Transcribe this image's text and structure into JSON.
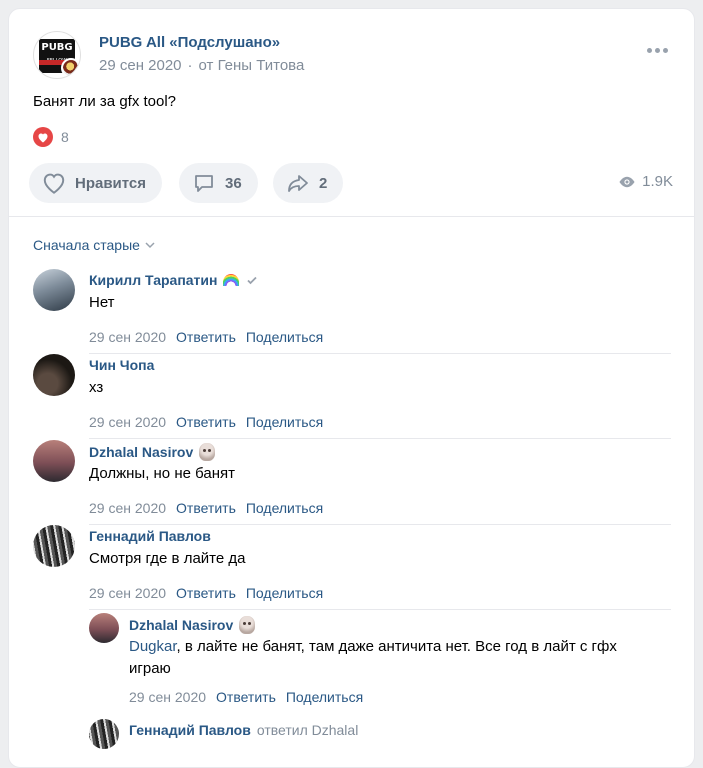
{
  "post": {
    "group_name": "PUBG All «Подслушано»",
    "date": "29 сен 2020",
    "author": "от Гены Титова",
    "avatar_logo": "PUBG",
    "avatar_sub": "FELLOW",
    "text": "Банят ли за gfx tool?",
    "likes_count": "8",
    "actions": {
      "like_label": "Нравится",
      "comments_count": "36",
      "shares_count": "2",
      "views": "1.9K"
    }
  },
  "comments": {
    "sort_label": "Сначала старые",
    "items": [
      {
        "name": "Кирилл Тарапатин",
        "text": "Нет",
        "date": "29 сен 2020",
        "reply": "Ответить",
        "share": "Поделиться",
        "avatar_color": "#6b7a89"
      },
      {
        "name": "Чин Чопа",
        "text": "хз",
        "date": "29 сен 2020",
        "reply": "Ответить",
        "share": "Поделиться",
        "avatar_color": "#2b2420"
      },
      {
        "name": "Dzhalal Nasirov",
        "text": "Должны, но не банят",
        "date": "29 сен 2020",
        "reply": "Ответить",
        "share": "Поделиться",
        "avatar_color": "#8a5d5a"
      },
      {
        "name": "Геннадий Павлов",
        "text": "Смотря где в лайте да",
        "date": "29 сен 2020",
        "reply": "Ответить",
        "share": "Поделиться",
        "avatar_color": "#444"
      }
    ],
    "nested": [
      {
        "name": "Dzhalal Nasirov",
        "mention": "Dugkar",
        "text_line1": ", в лайте не банят, там даже античита нет. Все год в лайт с гфх",
        "text_line2": "играю",
        "date": "29 сен 2020",
        "reply": "Ответить",
        "share": "Поделиться"
      },
      {
        "name": "Геннадий Павлов",
        "replied": "ответил Dzhalal"
      }
    ]
  },
  "colors": {
    "link": "#2a5885",
    "muted": "#818c99",
    "like_red": "#e64646"
  },
  "icons": [
    "more-icon",
    "heart-icon",
    "comment-icon",
    "share-icon",
    "eye-icon",
    "chevron-down-icon",
    "verified-icon",
    "rainbow-emoji",
    "face-emoji"
  ]
}
